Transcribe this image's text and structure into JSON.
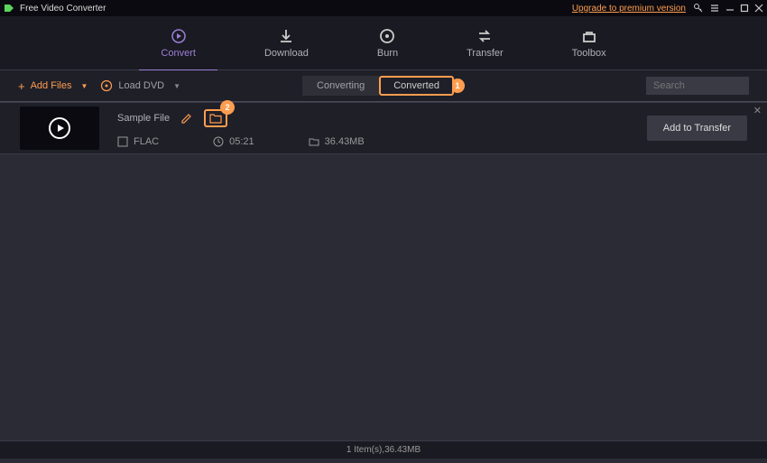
{
  "app": {
    "title": "Free Video Converter",
    "upgrade": "Upgrade to premium version"
  },
  "nav": {
    "convert": "Convert",
    "download": "Download",
    "burn": "Burn",
    "transfer": "Transfer",
    "toolbox": "Toolbox"
  },
  "toolbar": {
    "add_files": "Add Files",
    "load_dvd": "Load DVD",
    "tab_converting": "Converting",
    "tab_converted": "Converted",
    "callout1": "1",
    "callout2": "2",
    "search_placeholder": "Search"
  },
  "file": {
    "name": "Sample File",
    "format": "FLAC",
    "duration": "05:21",
    "size": "36.43MB",
    "add_transfer": "Add to Transfer"
  },
  "status": "1 Item(s),36.43MB"
}
